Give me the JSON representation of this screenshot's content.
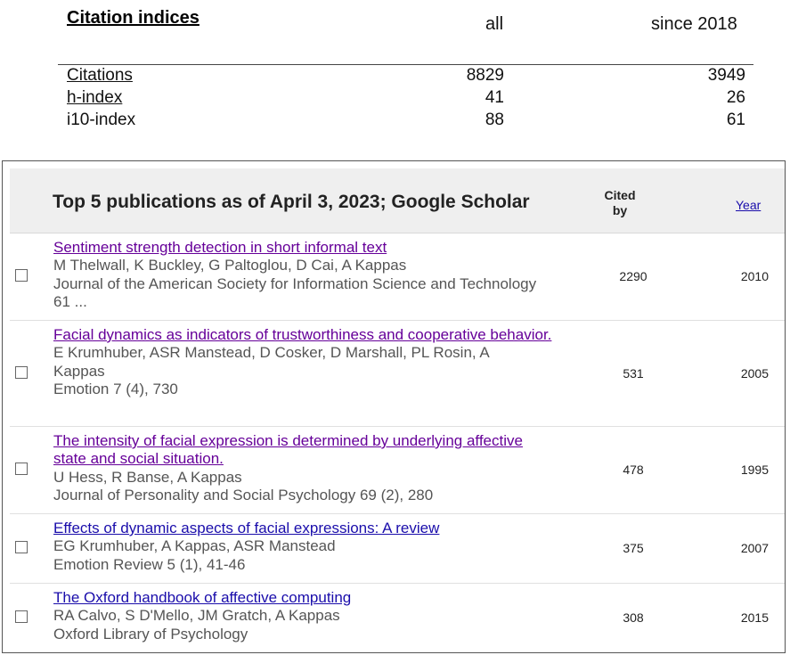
{
  "citation_indices": {
    "title": "Citation indices",
    "col_all": "all",
    "col_since": "since 2018",
    "rows": [
      {
        "label": "Citations",
        "all": "8829",
        "since": "3949"
      },
      {
        "label": "h-index",
        "all": "41",
        "since": "26"
      },
      {
        "label": "i10-index",
        "all": "88",
        "since": "61"
      }
    ]
  },
  "publications": {
    "header_title": "Top 5 publications as of April 3, 2023; Google Scholar",
    "cited_by_line1": "Cited",
    "cited_by_line2": "by",
    "year_label": "Year",
    "rows": [
      {
        "title": "Sentiment strength detection in short informal text",
        "authors": "M Thelwall, K Buckley, G Paltoglou, D Cai, A Kappas",
        "venue": "Journal of the American Society for Information Science and Technology 61 ...",
        "cited_by": "2290",
        "year": "2010"
      },
      {
        "title": "Facial dynamics as indicators of trustworthiness and cooperative behavior.",
        "authors": "E Krumhuber, ASR Manstead, D Cosker, D Marshall, PL Rosin, A Kappas",
        "venue": "Emotion 7 (4), 730",
        "cited_by": "531",
        "year": "2005"
      },
      {
        "title": "The intensity of facial expression is determined by underlying affective state and social situation.",
        "authors": "U Hess, R Banse, A Kappas",
        "venue": "Journal of Personality and Social Psychology 69 (2), 280",
        "cited_by": "478",
        "year": "1995"
      },
      {
        "title": "Effects of dynamic aspects of facial expressions: A review",
        "authors": "EG Krumhuber, A Kappas, ASR Manstead",
        "venue": "Emotion Review 5 (1), 41-46",
        "cited_by": "375",
        "year": "2007"
      },
      {
        "title": "The Oxford handbook of affective computing",
        "authors": "RA Calvo, S D'Mello, JM Gratch, A Kappas",
        "venue": "Oxford Library of Psychology",
        "cited_by": "308",
        "year": "2015"
      }
    ]
  }
}
